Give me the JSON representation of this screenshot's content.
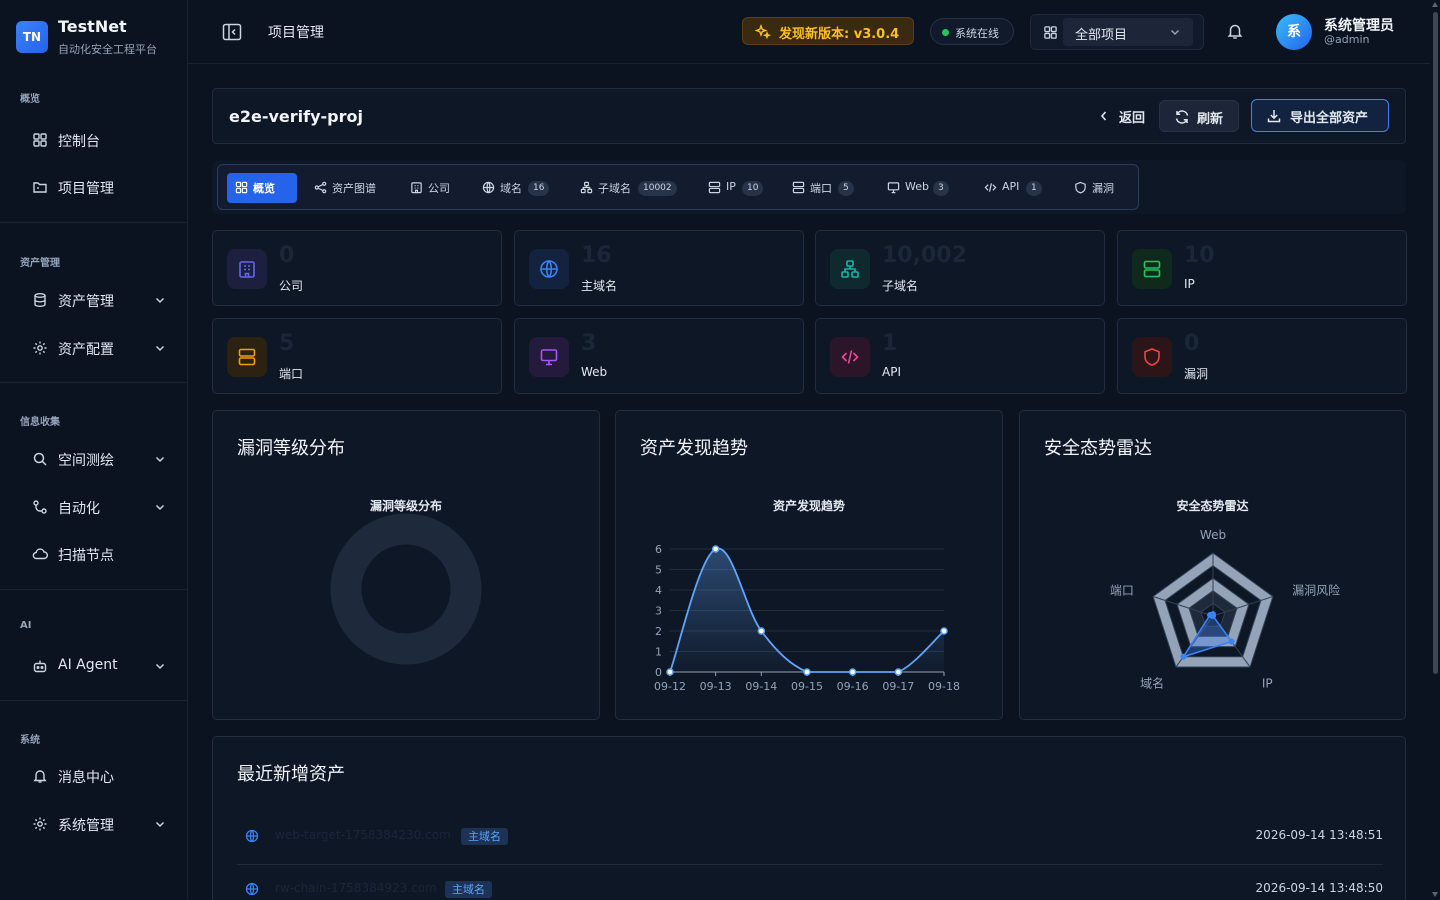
{
  "app": {
    "logo_text": "TN",
    "name": "TestNet",
    "subtitle": "自动化安全工程平台"
  },
  "sidebar": {
    "sections": [
      {
        "title": "概览",
        "items": [
          {
            "label": "控制台",
            "icon": "dashboard-icon"
          },
          {
            "label": "项目管理",
            "icon": "folder-icon"
          }
        ]
      },
      {
        "title": "资产管理",
        "items": [
          {
            "label": "资产管理",
            "icon": "database-icon",
            "expandable": true
          },
          {
            "label": "资产配置",
            "icon": "gear-icon",
            "expandable": true
          }
        ]
      },
      {
        "title": "信息收集",
        "items": [
          {
            "label": "空间测绘",
            "icon": "search-icon",
            "expandable": true
          },
          {
            "label": "自动化",
            "icon": "workflow-icon",
            "expandable": true
          },
          {
            "label": "扫描节点",
            "icon": "cloud-icon"
          }
        ]
      },
      {
        "title": "AI",
        "items": [
          {
            "label": "AI Agent",
            "icon": "bot-icon",
            "expandable": true
          }
        ]
      },
      {
        "title": "系统",
        "items": [
          {
            "label": "消息中心",
            "icon": "bell-icon"
          },
          {
            "label": "系统管理",
            "icon": "gear-icon",
            "expandable": true
          }
        ]
      }
    ]
  },
  "topbar": {
    "breadcrumb": "项目管理",
    "update_label": "发现新版本: v3.0.4",
    "status_label": "系统在线",
    "project_select": "全部项目",
    "user": {
      "avatar": "系",
      "name": "系统管理员",
      "handle": "@admin"
    }
  },
  "project": {
    "name": "e2e-verify-proj",
    "back_label": "返回",
    "refresh_label": "刷新",
    "export_label": "导出全部资产"
  },
  "tabs": [
    {
      "label": "概览",
      "icon": "grid-icon",
      "count": null,
      "active": true
    },
    {
      "label": "资产图谱",
      "icon": "share-icon",
      "count": null
    },
    {
      "label": "公司",
      "icon": "building-icon",
      "count": null
    },
    {
      "label": "域名",
      "icon": "globe-icon",
      "count": "16"
    },
    {
      "label": "子域名",
      "icon": "network-icon",
      "count": "10002"
    },
    {
      "label": "IP",
      "icon": "server-icon",
      "count": "10"
    },
    {
      "label": "端口",
      "icon": "server-icon",
      "count": "5"
    },
    {
      "label": "Web",
      "icon": "monitor-icon",
      "count": "3"
    },
    {
      "label": "API",
      "icon": "code-icon",
      "count": "1"
    },
    {
      "label": "漏洞",
      "icon": "shield-icon",
      "count": null
    }
  ],
  "stats": [
    {
      "value": "0",
      "label": "公司",
      "icon": "building-icon",
      "color": "#6366f1"
    },
    {
      "value": "16",
      "label": "主域名",
      "icon": "globe-icon",
      "color": "#3b82f6"
    },
    {
      "value": "10,002",
      "label": "子域名",
      "icon": "network-icon",
      "color": "#14b8a6"
    },
    {
      "value": "10",
      "label": "IP",
      "icon": "server-icon",
      "color": "#22c55e"
    },
    {
      "value": "5",
      "label": "端口",
      "icon": "server-icon",
      "color": "#f59e0b"
    },
    {
      "value": "3",
      "label": "Web",
      "icon": "monitor-icon",
      "color": "#a855f7"
    },
    {
      "value": "1",
      "label": "API",
      "icon": "code-icon",
      "color": "#ec4899"
    },
    {
      "value": "0",
      "label": "漏洞",
      "icon": "shield-icon",
      "color": "#ef4444"
    }
  ],
  "panels": {
    "vuln": {
      "title": "漏洞等级分布",
      "chart_title": "漏洞等级分布"
    },
    "trend": {
      "title": "资产发现趋势",
      "chart_title": "资产发现趋势"
    },
    "radar": {
      "title": "安全态势雷达",
      "chart_title": "安全态势雷达"
    }
  },
  "chart_data": [
    {
      "type": "pie",
      "title": "漏洞等级分布",
      "categories": [],
      "values": [],
      "empty": true,
      "color": "#1e293b"
    },
    {
      "type": "area",
      "title": "资产发现趋势",
      "x": [
        "09-12",
        "09-13",
        "09-14",
        "09-15",
        "09-16",
        "09-17",
        "09-18"
      ],
      "y": [
        0,
        6,
        2,
        0,
        0,
        0,
        2
      ],
      "ylim": [
        0,
        6
      ],
      "yticks": [
        0,
        1,
        2,
        3,
        4,
        5,
        6
      ],
      "smooth": true,
      "grid": true,
      "color": "#60a5fa"
    },
    {
      "type": "radar",
      "title": "安全态势雷达",
      "indicators": [
        "Web",
        "漏洞风险",
        "IP",
        "域名",
        "端口"
      ],
      "values": [
        3,
        0,
        10,
        16,
        5
      ],
      "max": [
        100,
        100,
        20,
        20,
        100
      ],
      "color": "#3b82f6"
    }
  ],
  "recent": {
    "title": "最近新增资产",
    "rows": [
      {
        "host": "web-target-1758384230.com",
        "tag": "主域名",
        "time": "2026-09-14 13:48:51",
        "icon": "globe-icon"
      },
      {
        "host": "rw-chain-1758384923.com",
        "tag": "主域名",
        "time": "2026-09-14 13:48:50",
        "icon": "globe-icon"
      }
    ]
  }
}
